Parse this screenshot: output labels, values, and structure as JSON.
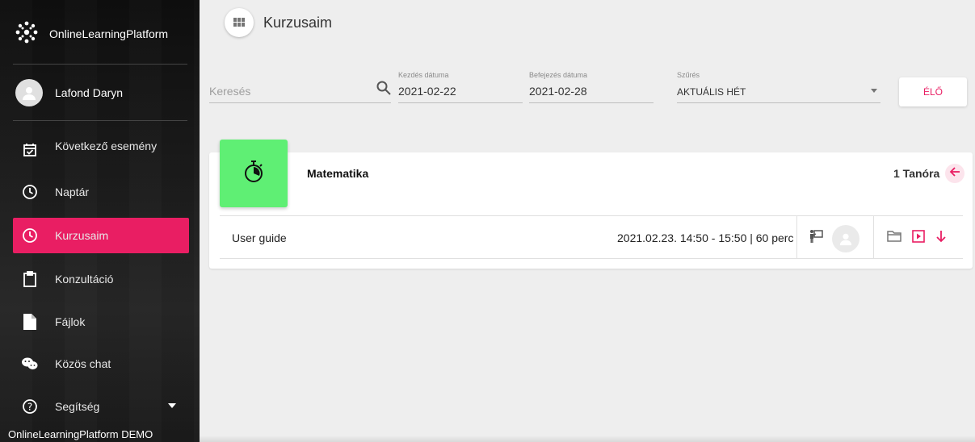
{
  "sidebar": {
    "brand": "OnlineLearningPlatform",
    "user_name": "Lafond Daryn",
    "items": [
      {
        "label": "Következő esemény",
        "icon": "calendar-check-icon"
      },
      {
        "label": "Naptár",
        "icon": "clock-icon"
      },
      {
        "label": "Kurzusaim",
        "icon": "clock-icon"
      },
      {
        "label": "Konzultáció",
        "icon": "clipboard-icon"
      },
      {
        "label": "Fájlok",
        "icon": "file-icon"
      },
      {
        "label": "Közös chat",
        "icon": "chat-icon"
      },
      {
        "label": "Segítség",
        "icon": "help-icon"
      }
    ],
    "footer": "OnlineLearningPlatform DEMO"
  },
  "header": {
    "title": "Kurzusaim",
    "icon": "grid-icon"
  },
  "filters": {
    "search_placeholder": "Keresés",
    "start_label": "Kezdés dátuma",
    "start_value": "2021-02-22",
    "end_label": "Befejezés dátuma",
    "end_value": "2021-02-28",
    "filter_label": "Szűrés",
    "filter_value": "AKTUÁLIS HÉT",
    "live_button": "ÉLŐ"
  },
  "course": {
    "name": "Matematika",
    "lessons": "1 Tanóra",
    "badge_icon": "timer-icon",
    "rows": [
      {
        "title": "User guide",
        "time": "2021.02.23. 14:50 - 15:50 | 60 perc"
      }
    ]
  },
  "colors": {
    "accent": "#e91e63",
    "badge": "#5fef74"
  }
}
